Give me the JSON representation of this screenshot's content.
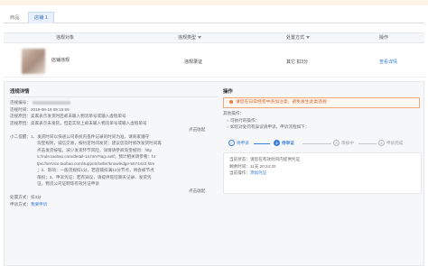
{
  "tabs": [
    {
      "label": "商品",
      "active": false
    },
    {
      "label": "店铺 1",
      "active": true
    }
  ],
  "table": {
    "headers": [
      "违规对象",
      "违规类型",
      "处置方式",
      "操作"
    ],
    "row": {
      "object": "店铺违规",
      "type": "违规录证",
      "method": "其它 扣3分",
      "action": "查看详情"
    }
  },
  "detail": {
    "title": "违规详情",
    "number_label": "违规编号：",
    "time": "违规时间：2019-08-19 09:16:59",
    "reason1": "违规原因：卖家表示发货时后却未输入物流单号或输入虚假单号",
    "reason2": "违规原因：卖家表示未发货，但是实际上却未输入物流单号或输入虚假单号",
    "expand1": "点击收起",
    "tips": [
      "小二提醒：1、发货时间以快递公司系统内揽件记录的时间为准，请商家遵守",
      "淘宝规则，诚信交易，按约定时间发货；建议您及时修改发货时间再",
      "点击发货按钮，减少发货环节风险，详情请参阅淘宝规则：http",
      "s://rule.taobao.com/detail-14.htm?tag=self；预计相关请参看：ht",
      "tps://service.taobao.com/support/seller/knowledge-5674422.htm",
      "；2、影响：一般违规扣1分，若店铺扣满12分节点，将会被节点",
      "限权；3、申诉凭证：若有异议，请提供旺旺聊天记录、发货凭",
      "证，物流公司证明等有效凭证申诉"
    ],
    "expand2": "点击收起",
    "penalty": "处置方式：扣3分",
    "appeal_prefix": "申诉方式：",
    "appeal_link": "我要申诉"
  },
  "operation": {
    "title": "操作",
    "warning": "请您在日常经营中多加注意，避免发生此类违规",
    "other_title": "其他操作：",
    "option1": "○ 可执行的操作：",
    "option2": "○ 如您对处罚有异议请申诉，申诉流程如下：",
    "steps": [
      {
        "num": "✓",
        "label": "待申诉",
        "state": "done"
      },
      {
        "num": "2",
        "label": "待举证",
        "state": "on"
      },
      {
        "num": "3",
        "label": "审核中",
        "state": "off"
      },
      {
        "num": "4",
        "label": "申诉完成",
        "state": "off"
      }
    ],
    "status": "当前状态：请您在有效时间内提供凭证",
    "deadline": "剩余时间：11天 20:24:20",
    "upload_prefix": "当前操作：",
    "upload_link": "添加凭证"
  }
}
